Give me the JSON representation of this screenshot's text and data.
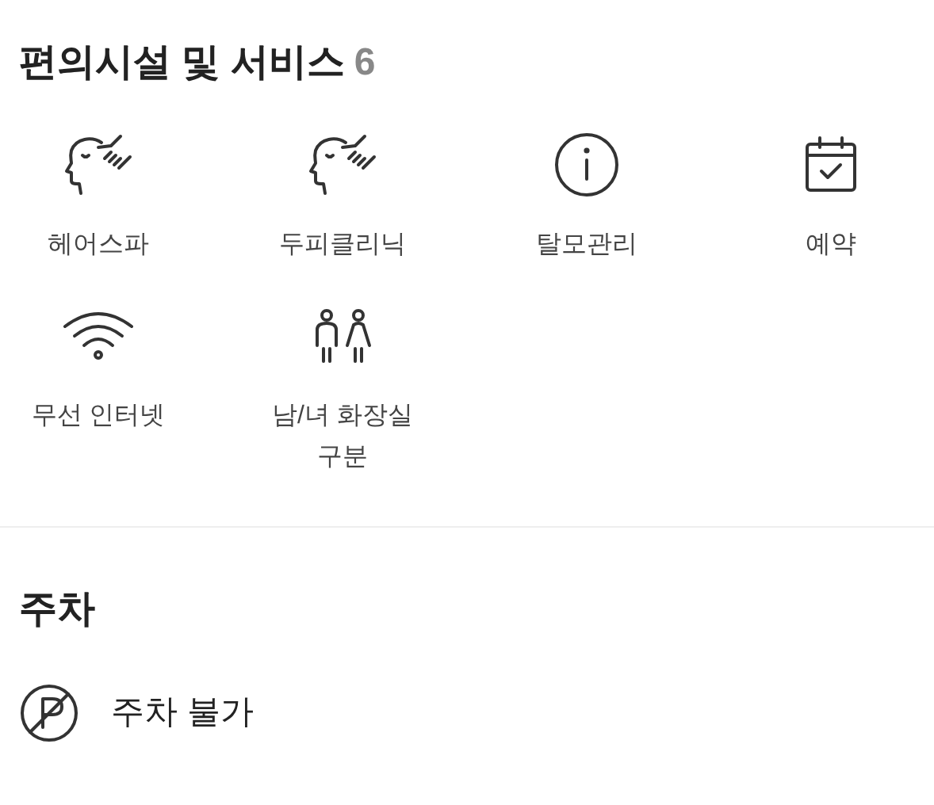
{
  "facilities": {
    "title": "편의시설 및 서비스",
    "count": "6",
    "items": [
      {
        "kind": "face",
        "label": "헤어스파"
      },
      {
        "kind": "face",
        "label": "두피클리닉"
      },
      {
        "kind": "info",
        "label": "탈모관리"
      },
      {
        "kind": "calendar",
        "label": "예약"
      },
      {
        "kind": "wifi",
        "label": "무선 인터넷"
      },
      {
        "kind": "restroom",
        "label": "남/녀 화장실 구분"
      }
    ]
  },
  "parking": {
    "title": "주차",
    "items": [
      {
        "kind": "no-parking",
        "label": "주차 불가"
      }
    ]
  }
}
